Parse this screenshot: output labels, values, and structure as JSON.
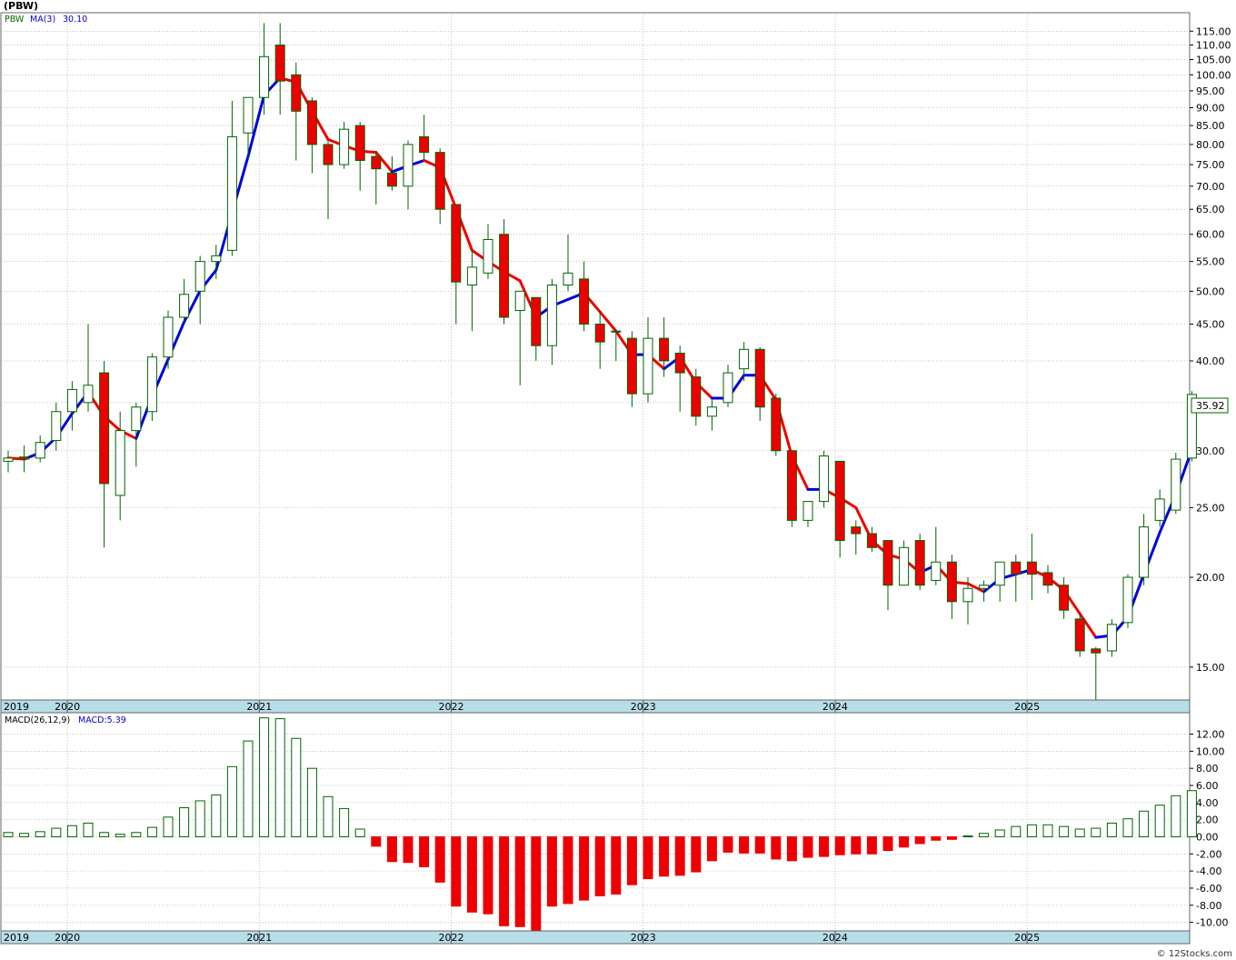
{
  "header": {
    "title": "(PBW)"
  },
  "footer": {
    "credit": "© 12Stocks.com"
  },
  "colors": {
    "up": "#006400",
    "down": "#ee0000",
    "ma_up": "#0000dd",
    "ma_down": "#ee0000",
    "grid": "#a0a0a0",
    "axis_band": "#b7dde8"
  },
  "legend": {
    "price": {
      "symbol": "PBW",
      "ma_label": "MA(3)",
      "ma_value": "30.10"
    },
    "macd": {
      "label": "MACD(26,12,9)",
      "value_label": "MACD:5.39"
    }
  },
  "last_price_label": "35.92",
  "chart_data": [
    {
      "type": "candlestick",
      "series_name": "PBW",
      "interval": "monthly",
      "y_scale": "log",
      "ylim": [
        13.5,
        122
      ],
      "y_ticks": [
        "15.00",
        "20.00",
        "25.00",
        "30.00",
        "35.00",
        "40.00",
        "45.00",
        "50.00",
        "55.00",
        "60.00",
        "65.00",
        "70.00",
        "75.00",
        "80.00",
        "85.00",
        "90.00",
        "95.00",
        "100.00",
        "105.00",
        "110.00",
        "115.00"
      ],
      "x_year_labels": [
        "2019",
        "2020",
        "2021",
        "2022",
        "2023",
        "2024",
        "2025"
      ],
      "grid": true,
      "ohlc": [
        [
          29,
          30,
          28,
          29.3
        ],
        [
          29.4,
          30.5,
          28,
          29.2
        ],
        [
          29.3,
          31.5,
          28.9,
          30.8
        ],
        [
          31,
          35,
          30,
          34
        ],
        [
          34,
          37.5,
          32,
          36.5
        ],
        [
          35,
          45,
          34,
          37
        ],
        [
          38.5,
          40,
          22,
          27
        ],
        [
          26,
          34,
          24,
          32
        ],
        [
          32,
          35,
          28.5,
          34.5
        ],
        [
          34,
          41,
          33,
          40.5
        ],
        [
          40.5,
          47,
          39,
          46
        ],
        [
          46,
          52,
          45,
          49.5
        ],
        [
          50,
          56,
          45,
          55
        ],
        [
          55,
          58,
          52,
          56
        ],
        [
          57,
          92,
          56,
          82
        ],
        [
          83,
          88,
          76,
          93
        ],
        [
          93,
          118,
          88,
          106
        ],
        [
          110,
          118,
          88,
          98
        ],
        [
          100,
          104,
          76,
          89
        ],
        [
          92,
          93,
          73,
          80
        ],
        [
          80,
          81,
          63,
          75
        ],
        [
          75,
          86,
          74,
          84
        ],
        [
          85,
          86,
          69,
          76
        ],
        [
          77,
          78,
          66,
          74
        ],
        [
          73,
          77,
          69,
          70
        ],
        [
          70,
          81,
          65,
          80
        ],
        [
          82,
          88,
          76,
          78
        ],
        [
          78,
          79,
          62,
          65
        ],
        [
          66,
          66,
          45,
          51.5
        ],
        [
          51,
          57,
          44,
          54
        ],
        [
          53,
          62,
          52,
          59
        ],
        [
          60,
          63,
          45,
          46
        ],
        [
          47,
          50,
          37,
          50
        ],
        [
          49,
          49,
          40,
          42
        ],
        [
          42,
          52,
          39.5,
          51
        ],
        [
          51,
          60,
          50,
          53
        ],
        [
          52,
          55,
          44,
          45
        ],
        [
          45,
          47,
          39,
          42.5
        ],
        [
          44,
          44,
          40,
          44
        ],
        [
          43,
          44,
          34.5,
          36
        ],
        [
          36,
          46,
          35,
          43
        ],
        [
          43,
          46,
          38,
          40
        ],
        [
          41,
          42,
          34,
          38.5
        ],
        [
          38,
          39,
          32.5,
          33.5
        ],
        [
          33.5,
          35.5,
          32,
          34.5
        ],
        [
          35,
          39.5,
          34.5,
          38.5
        ],
        [
          39,
          42.5,
          37.5,
          41.5
        ],
        [
          41.5,
          41.8,
          33,
          34.5
        ],
        [
          35.5,
          36,
          29.5,
          30
        ],
        [
          30,
          30,
          23.5,
          24
        ],
        [
          24,
          25.5,
          23.5,
          25.5
        ],
        [
          25.5,
          30,
          25,
          29.5
        ],
        [
          29,
          29,
          21.3,
          22.5
        ],
        [
          23.5,
          24,
          21.5,
          23
        ],
        [
          23,
          23.5,
          21.7,
          22
        ],
        [
          22.5,
          22.5,
          18,
          19.5
        ],
        [
          19.5,
          22.5,
          19.5,
          22
        ],
        [
          22.5,
          23,
          19.2,
          19.5
        ],
        [
          19.8,
          23.5,
          19.5,
          21
        ],
        [
          21,
          21.5,
          17.5,
          18.5
        ],
        [
          18.5,
          20,
          17.2,
          19.3
        ],
        [
          19.3,
          19.8,
          18.5,
          19.5
        ],
        [
          19.5,
          20.5,
          18.5,
          21
        ],
        [
          21,
          21.5,
          18.5,
          20.2
        ],
        [
          21,
          23,
          18.6,
          20.2
        ],
        [
          20.3,
          20.8,
          19,
          19.5
        ],
        [
          19.5,
          20,
          17.5,
          18
        ],
        [
          17.5,
          17.8,
          15.5,
          15.8
        ],
        [
          15.9,
          16,
          12.3,
          15.7
        ],
        [
          15.8,
          17.5,
          15.5,
          17.2
        ],
        [
          17.3,
          20.2,
          17,
          20
        ],
        [
          20,
          24.5,
          19.5,
          23.5
        ],
        [
          24,
          26.5,
          23.5,
          25.7
        ],
        [
          24.8,
          29.8,
          24.5,
          29.2
        ],
        [
          29.3,
          36.3,
          29,
          35.92
        ]
      ],
      "ma3": [
        29.3,
        29.2,
        29.8,
        31.3,
        33.8,
        36.2,
        33.5,
        32.0,
        31.2,
        35.7,
        40.2,
        45.3,
        50.1,
        53.5,
        64.3,
        77.0,
        93.7,
        99.0,
        97.7,
        89.0,
        81.3,
        79.7,
        78.3,
        78.0,
        73.3,
        74.7,
        76.0,
        74.3,
        65.2,
        57.0,
        55.0,
        53.2,
        51.7,
        46.0,
        47.7,
        48.7,
        49.7,
        46.8,
        44.0,
        40.8,
        40.8,
        39.0,
        40.5,
        37.3,
        35.5,
        35.5,
        38.2,
        38.2,
        35.3,
        29.5,
        26.5,
        26.5,
        25.8,
        25.0,
        22.5,
        21.5,
        21.2,
        20.3,
        20.8,
        19.7,
        19.6,
        19.1,
        19.9,
        20.2,
        20.5,
        20.0,
        19.2,
        17.8,
        16.5,
        16.6,
        17.6,
        20.2,
        23.1,
        26.1,
        30.1
      ]
    },
    {
      "type": "bar",
      "series_name": "MACD(26,12,9)",
      "ylim": [
        -11,
        14.5
      ],
      "y_ticks": [
        "-10.00",
        "-8.00",
        "-6.00",
        "-4.00",
        "-2.00",
        "0.00",
        "2.00",
        "4.00",
        "6.00",
        "8.00",
        "10.00",
        "12.00"
      ],
      "values": [
        0.5,
        0.4,
        0.6,
        1.0,
        1.3,
        1.6,
        0.5,
        0.3,
        0.5,
        1.1,
        2.3,
        3.4,
        4.2,
        4.9,
        8.2,
        11.2,
        13.9,
        13.8,
        11.5,
        8.0,
        4.7,
        3.3,
        0.9,
        -1.1,
        -2.9,
        -3.0,
        -3.5,
        -5.3,
        -8.1,
        -8.8,
        -9.0,
        -10.4,
        -10.5,
        -10.9,
        -8.1,
        -7.8,
        -7.4,
        -6.9,
        -6.7,
        -5.6,
        -4.9,
        -4.6,
        -4.5,
        -4.1,
        -2.8,
        -1.8,
        -1.9,
        -1.9,
        -2.6,
        -2.8,
        -2.4,
        -2.3,
        -2.1,
        -2.0,
        -2.0,
        -1.6,
        -1.2,
        -0.8,
        -0.4,
        -0.3,
        0.1,
        0.4,
        0.8,
        1.2,
        1.4,
        1.4,
        1.2,
        0.9,
        1.0,
        1.6,
        2.1,
        3.0,
        3.7,
        4.8,
        5.39
      ]
    }
  ]
}
